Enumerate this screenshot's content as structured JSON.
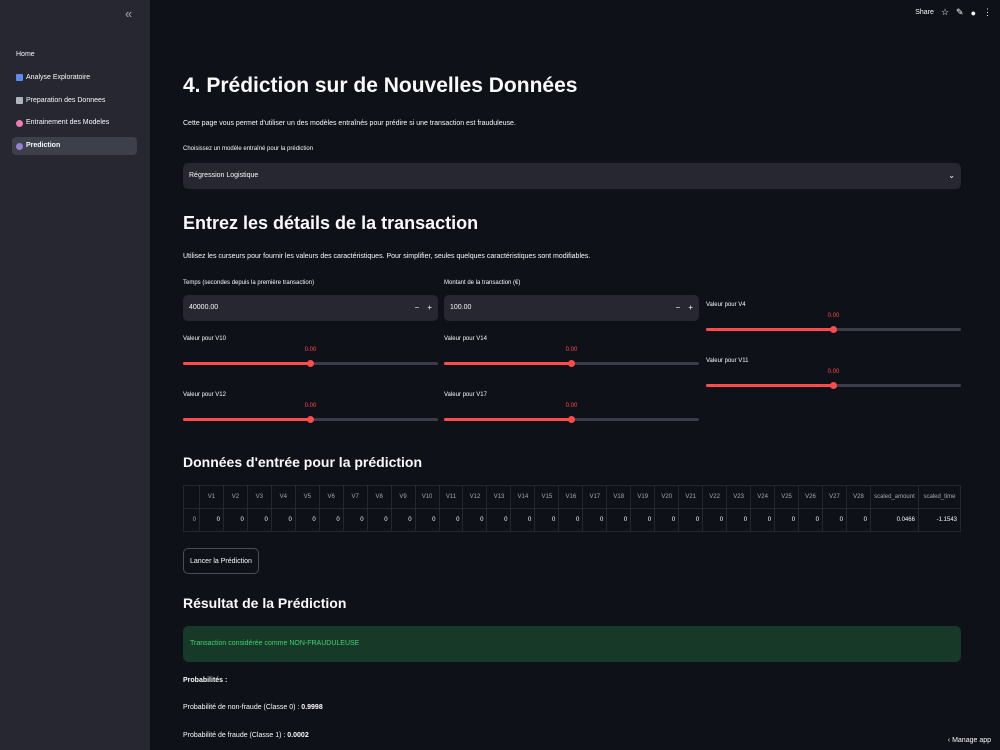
{
  "sidebar": {
    "collapse_glyph": "«",
    "items": [
      {
        "label": "Home",
        "icon": "none",
        "active": false
      },
      {
        "label": "Analyse Exploratoire",
        "icon": "chart-icon",
        "active": false
      },
      {
        "label": "Preparation des Donnees",
        "icon": "tools-icon",
        "active": false
      },
      {
        "label": "Entrainement des Modeles",
        "icon": "brain-icon",
        "active": false
      },
      {
        "label": "Prediction",
        "icon": "crystal-ball-icon",
        "active": true
      }
    ]
  },
  "topbar": {
    "share_label": "Share"
  },
  "page": {
    "title": "4. Prédiction sur de Nouvelles Données",
    "intro": "Cette page vous permet d'utiliser un des modèles entraînés pour prédire si une transaction est frauduleuse.",
    "model_label": "Choisissez un modèle entraîné pour la prédiction",
    "model_value": "Régression Logistique",
    "details_title": "Entrez les détails de la transaction",
    "details_intro": "Utilisez les curseurs pour fournir les valeurs des caractéristiques. Pour simplifier, seules quelques caractéristiques sont modifiables.",
    "time_label": "Temps (secondes depuis la première transaction)",
    "time_value": "40000.00",
    "amount_label": "Montant de la transaction (€)",
    "amount_value": "100.00",
    "sliders": [
      {
        "label": "Valeur pour V4",
        "value": "0.00",
        "position": 0.5
      },
      {
        "label": "Valeur pour V10",
        "value": "0.00",
        "position": 0.5
      },
      {
        "label": "Valeur pour V14",
        "value": "0.00",
        "position": 0.5
      },
      {
        "label": "Valeur pour V11",
        "value": "0.00",
        "position": 0.5
      },
      {
        "label": "Valeur pour V12",
        "value": "0.00",
        "position": 0.5
      },
      {
        "label": "Valeur pour V17",
        "value": "0.00",
        "position": 0.5
      }
    ],
    "input_title": "Données d'entrée pour la prédiction",
    "table": {
      "headers": [
        "",
        "V1",
        "V2",
        "V3",
        "V4",
        "V5",
        "V6",
        "V7",
        "V8",
        "V9",
        "V10",
        "V11",
        "V12",
        "V13",
        "V14",
        "V15",
        "V16",
        "V17",
        "V18",
        "V19",
        "V20",
        "V21",
        "V22",
        "V23",
        "V24",
        "V25",
        "V26",
        "V27",
        "V28",
        "scaled_amount",
        "scaled_time"
      ],
      "row": [
        "0",
        "0",
        "0",
        "0",
        "0",
        "0",
        "0",
        "0",
        "0",
        "0",
        "0",
        "0",
        "0",
        "0",
        "0",
        "0",
        "0",
        "0",
        "0",
        "0",
        "0",
        "0",
        "0",
        "0",
        "0",
        "0",
        "0",
        "0",
        "0",
        "0.0466",
        "-1.1543"
      ]
    },
    "predict_button": "Lancer la Prédiction",
    "result_title": "Résultat de la Prédiction",
    "result_message": "Transaction considérée comme NON-FRAUDULEUSE",
    "probs_title": "Probabilités :",
    "prob_nonfraud_label": "Probabilité de non-fraude (Classe 0) :",
    "prob_nonfraud_value": "0.9998",
    "prob_fraud_label": "Probabilité de fraude (Classe 1) :",
    "prob_fraud_value": "0.0002"
  },
  "footer": {
    "manage_app": "Manage app"
  },
  "colors": {
    "accent": "#ff4b4b",
    "success_bg": "#173928",
    "success_text": "#3dd56d",
    "sidebar_bg": "#262730",
    "app_bg": "#0e1117"
  }
}
